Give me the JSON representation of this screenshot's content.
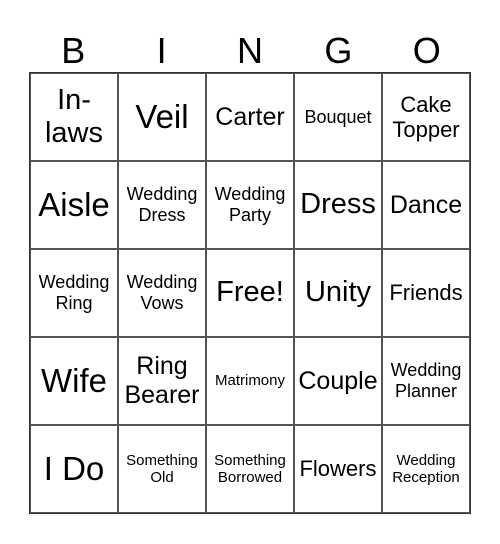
{
  "card": {
    "header": [
      "B",
      "I",
      "N",
      "G",
      "O"
    ],
    "cells": [
      [
        "In-laws",
        "Veil",
        "Carter",
        "Bouquet",
        "Cake Topper"
      ],
      [
        "Aisle",
        "Wedding Dress",
        "Wedding Party",
        "Dress",
        "Dance"
      ],
      [
        "Wedding Ring",
        "Wedding Vows",
        "Free!",
        "Unity",
        "Friends"
      ],
      [
        "Wife",
        "Ring Bearer",
        "Matrimony",
        "Couple",
        "Wedding Planner"
      ],
      [
        "I Do",
        "Something Old",
        "Something Borrowed",
        "Flowers",
        "Wedding Reception"
      ]
    ],
    "free_space": "Free!"
  }
}
